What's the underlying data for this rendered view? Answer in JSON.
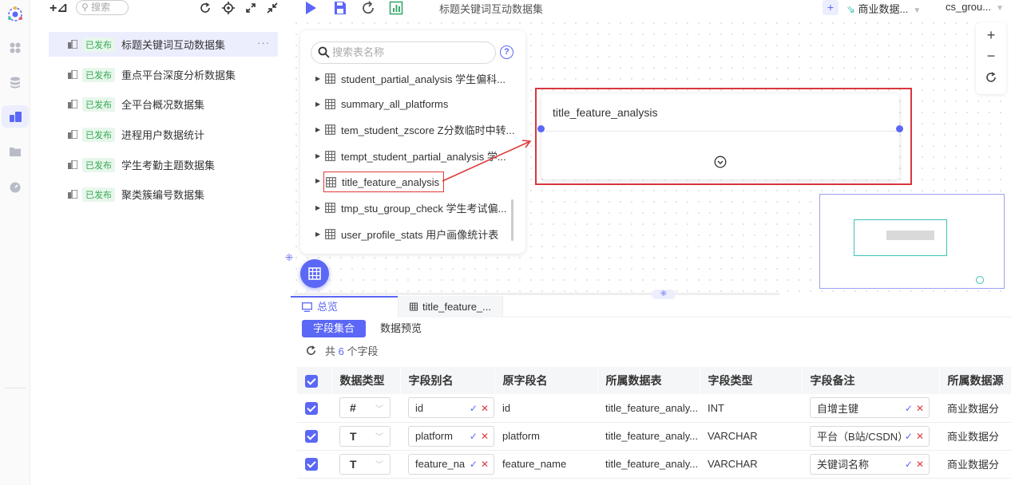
{
  "toolbar": {
    "title": "标题关键词互动数据集",
    "add_label": "+",
    "datasource": "商业数据...",
    "schema": "cs_grou..."
  },
  "list": {
    "search_placeholder": "搜索",
    "items": [
      {
        "status": "已发布",
        "name": "标题关键词互动数据集",
        "more": "···"
      },
      {
        "status": "已发布",
        "name": "重点平台深度分析数据集"
      },
      {
        "status": "已发布",
        "name": "全平台概况数据集"
      },
      {
        "status": "已发布",
        "name": "进程用户数据统计"
      },
      {
        "status": "已发布",
        "name": "学生考勤主题数据集"
      },
      {
        "status": "已发布",
        "name": "聚类簇编号数据集"
      }
    ]
  },
  "table_panel": {
    "search_placeholder": "搜索表名称",
    "help": "?",
    "tables": [
      "student_partial_analysis 学生偏科...",
      "summary_all_platforms",
      "tem_student_zscore Z分数临时中转...",
      "tempt_student_partial_analysis 学...",
      "title_feature_analysis",
      "tmp_stu_group_check 学生考试偏...",
      "user_profile_stats 用户画像统计表"
    ]
  },
  "node": {
    "title": "title_feature_analysis"
  },
  "zoom": {
    "in": "+",
    "out": "−"
  },
  "bottom": {
    "tabs": [
      "总览",
      "title_feature_..."
    ],
    "subtabs": [
      "字段集合",
      "数据预览"
    ],
    "count_prefix": "共",
    "count_value": "6",
    "count_suffix": "个字段",
    "columns": [
      "数据类型",
      "字段别名",
      "原字段名",
      "所属数据表",
      "字段类型",
      "字段备注",
      "所属数据源"
    ],
    "rows": [
      {
        "type": "#",
        "alias": "id",
        "orig": "id",
        "table": "title_feature_analy...",
        "ftype": "INT",
        "remark": "自增主键",
        "source": "商业数据分"
      },
      {
        "type": "T",
        "alias": "platform",
        "orig": "platform",
        "table": "title_feature_analy...",
        "ftype": "VARCHAR",
        "remark": "平台（B站/CSDN）",
        "source": "商业数据分"
      },
      {
        "type": "T",
        "alias": "feature_na",
        "orig": "feature_name",
        "table": "title_feature_analy...",
        "ftype": "VARCHAR",
        "remark": "关键词名称",
        "source": "商业数据分"
      }
    ]
  }
}
